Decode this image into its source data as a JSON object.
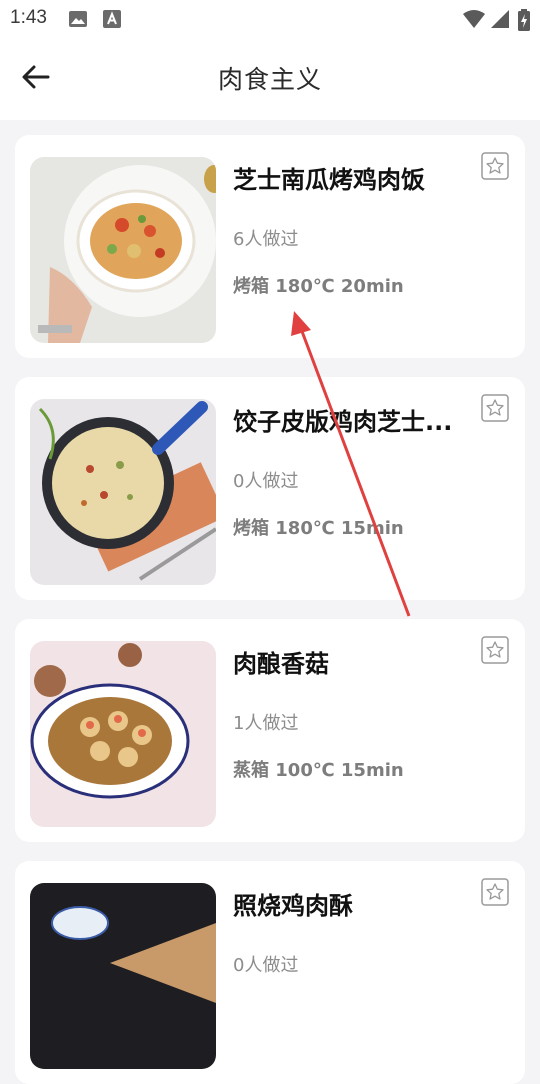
{
  "status_bar": {
    "time": "1:43"
  },
  "app_bar": {
    "title": "肉食主义"
  },
  "recipes": [
    {
      "title": "芝士南瓜烤鸡肉饭",
      "made_count": "6人做过",
      "cook_info": "烤箱 180℃ 20min"
    },
    {
      "title": "饺子皮版鸡肉芝士...",
      "made_count": "0人做过",
      "cook_info": "烤箱 180℃ 15min"
    },
    {
      "title": "肉酿香菇",
      "made_count": "1人做过",
      "cook_info": "蒸箱 100℃ 15min"
    },
    {
      "title": "照烧鸡肉酥",
      "made_count": "0人做过",
      "cook_info": ""
    }
  ],
  "colors": {
    "accent_arrow": "#e0403f",
    "card_bg": "#ffffff",
    "page_bg": "#f4f4f6"
  },
  "icons": [
    "image-icon",
    "a-badge-icon",
    "wifi-icon",
    "signal-icon",
    "battery-icon",
    "back-arrow-icon",
    "favorite-star-icon"
  ]
}
